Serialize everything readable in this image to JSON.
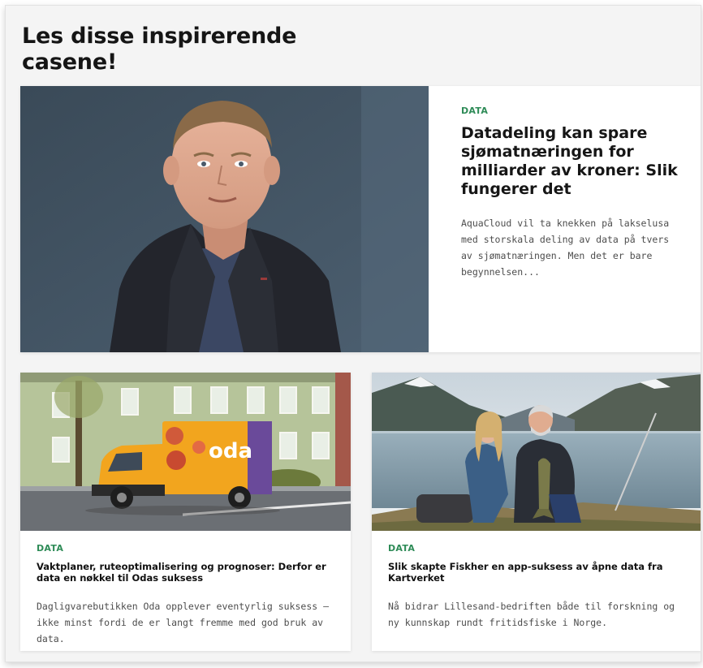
{
  "heading": "Les disse inspirerende casene!",
  "accent_color": "#2e8b57",
  "articles": [
    {
      "category": "DATA",
      "title": "Datadeling kan spare sjømatnæringen for milliarder av kroner: Slik fungerer det",
      "excerpt": "AquaCloud vil ta knekken på lakselusa med storskala deling av data på tvers av sjømatnæringen. Men det er bare begynnelsen...",
      "image": "portrait-photo"
    },
    {
      "category": "DATA",
      "title": "Vaktplaner, ruteoptimalisering og prognoser: Derfor er data en nøkkel til Odas suksess",
      "excerpt": "Dagligvarebutikken Oda opplever eventyrlig suksess – ikke minst fordi de er langt fremme med god bruk av data.",
      "image": "delivery-truck-photo",
      "image_text": "oda"
    },
    {
      "category": "DATA",
      "title": "Slik skapte Fiskher en app-suksess av åpne data fra Kartverket",
      "excerpt": "Nå bidrar Lillesand-bedriften både til forskning og ny kunnskap rundt fritidsfiske i Norge.",
      "image": "fishing-fjord-photo"
    }
  ]
}
